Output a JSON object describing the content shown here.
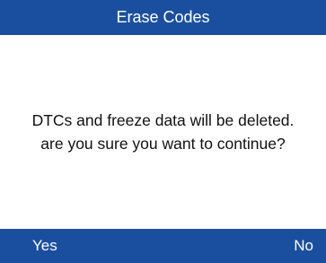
{
  "title": "Erase Codes",
  "message": {
    "line1": "DTCs and freeze data will be deleted.",
    "line2": "are you sure you want to continue?"
  },
  "softkeys": {
    "yes": "Yes",
    "no": "No"
  },
  "colors": {
    "bar_background": "#1a4fa0",
    "bar_text": "#ffffff",
    "body_background": "#ffffff",
    "body_text": "#111111"
  }
}
